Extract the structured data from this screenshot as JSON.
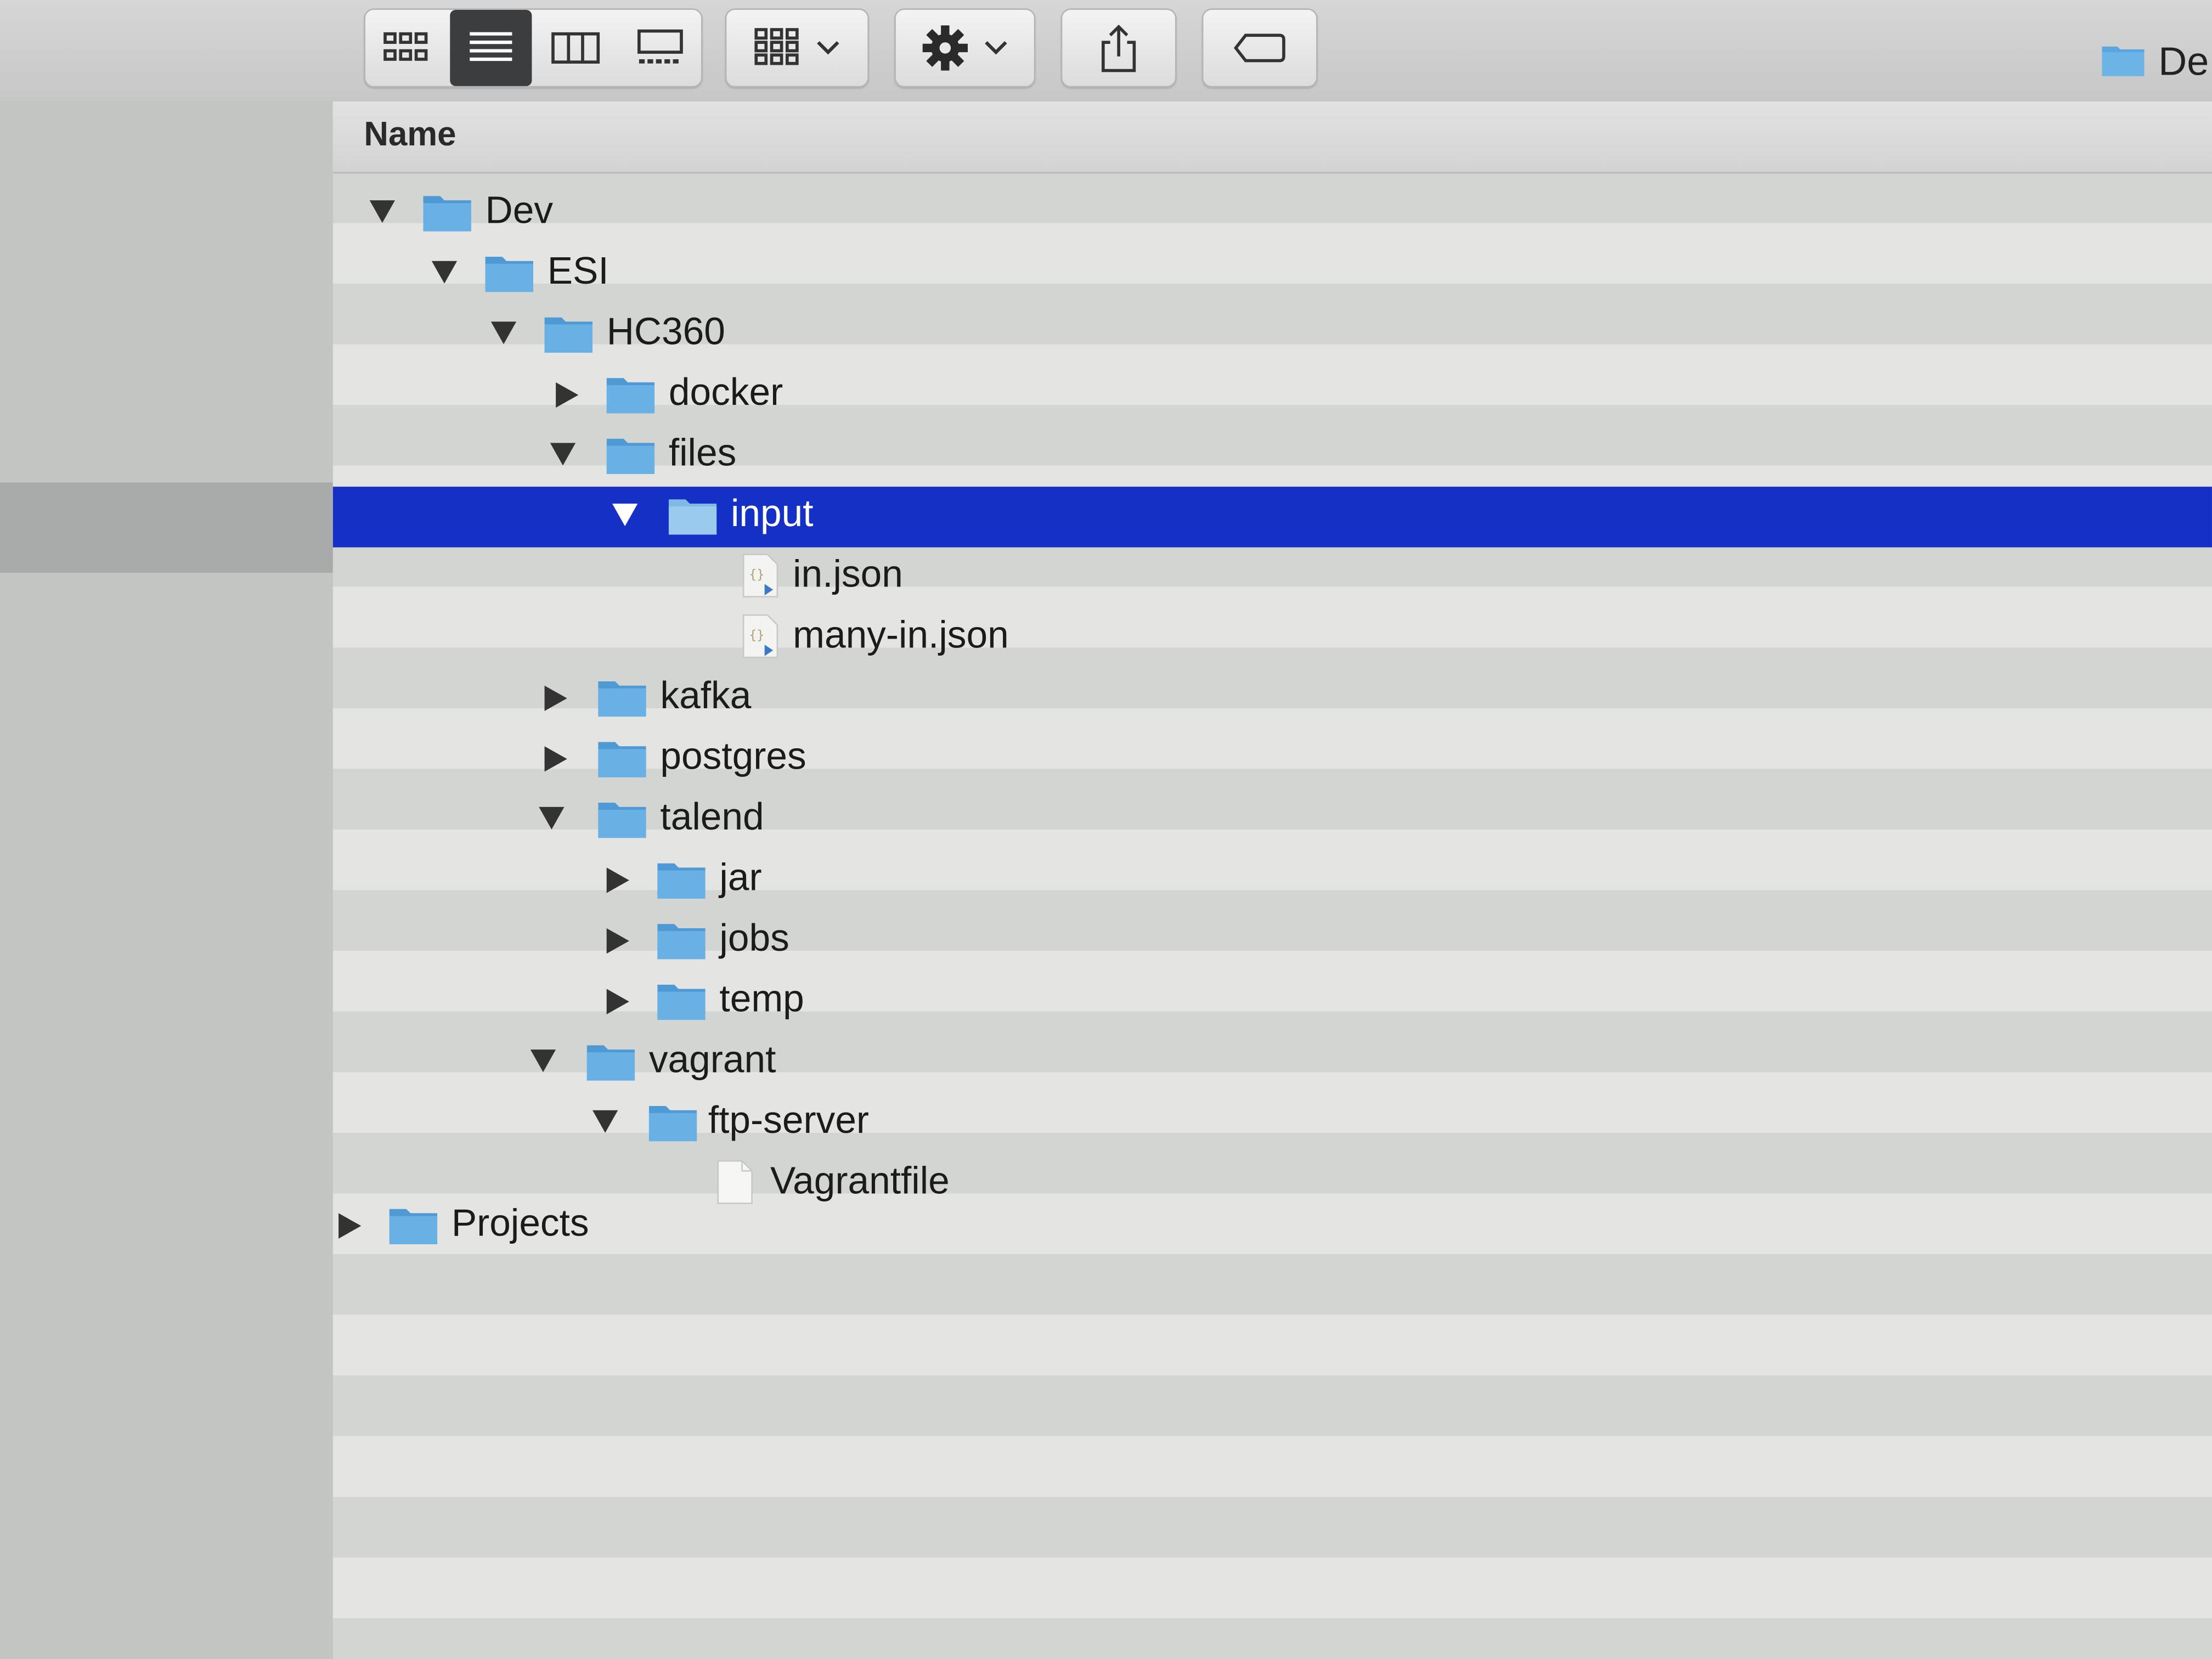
{
  "toolbar": {
    "view_buttons": [
      {
        "name": "icon-view"
      },
      {
        "name": "list-view"
      },
      {
        "name": "column-view"
      },
      {
        "name": "gallery-view"
      }
    ],
    "active_view": "list-view",
    "path_label": "De"
  },
  "column_header": {
    "name_label": "Name"
  },
  "tree": [
    {
      "label": "Dev",
      "type": "folder",
      "expanded": true
    },
    {
      "label": "ESI",
      "type": "folder",
      "expanded": true
    },
    {
      "label": "HC360",
      "type": "folder",
      "expanded": true
    },
    {
      "label": "docker",
      "type": "folder",
      "expanded": false
    },
    {
      "label": "files",
      "type": "folder",
      "expanded": true
    },
    {
      "label": "input",
      "type": "folder",
      "expanded": true,
      "selected": true
    },
    {
      "label": "in.json",
      "type": "json-file"
    },
    {
      "label": "many-in.json",
      "type": "json-file"
    },
    {
      "label": "kafka",
      "type": "folder",
      "expanded": false
    },
    {
      "label": "postgres",
      "type": "folder",
      "expanded": false
    },
    {
      "label": "talend",
      "type": "folder",
      "expanded": true
    },
    {
      "label": "jar",
      "type": "folder",
      "expanded": false
    },
    {
      "label": "jobs",
      "type": "folder",
      "expanded": false
    },
    {
      "label": "temp",
      "type": "folder",
      "expanded": false
    },
    {
      "label": "vagrant",
      "type": "folder",
      "expanded": true
    },
    {
      "label": "ftp-server",
      "type": "folder",
      "expanded": true
    },
    {
      "label": "Vagrantfile",
      "type": "plain-file"
    },
    {
      "label": "Projects",
      "type": "folder",
      "expanded": false
    }
  ],
  "colors": {
    "selection": "#1530c5",
    "folder": "#5aa6de"
  }
}
